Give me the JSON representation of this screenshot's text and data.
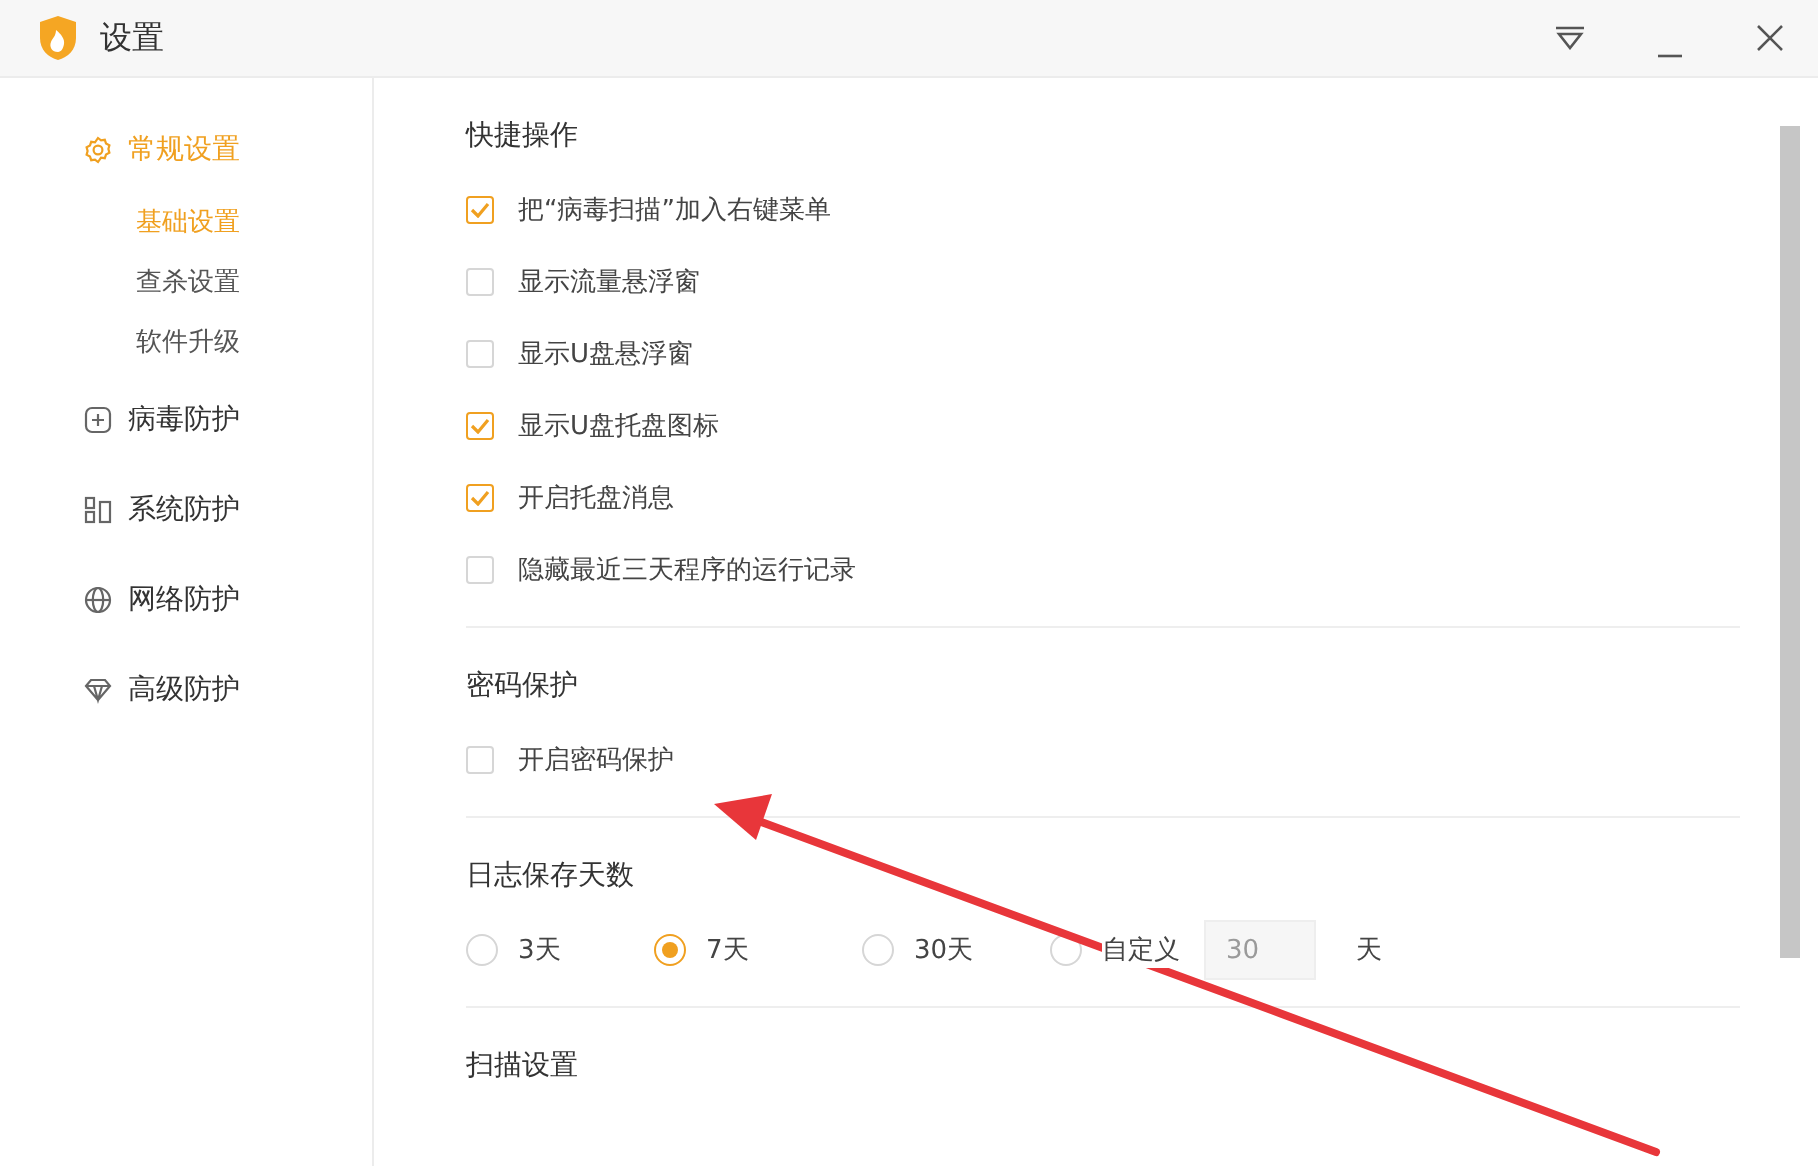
{
  "window": {
    "title": "设置"
  },
  "sidebar": {
    "items": [
      {
        "label": "常规设置",
        "selected": true,
        "children": [
          {
            "label": "基础设置",
            "selected": true
          },
          {
            "label": "查杀设置",
            "selected": false
          },
          {
            "label": "软件升级",
            "selected": false
          }
        ]
      },
      {
        "label": "病毒防护",
        "selected": false
      },
      {
        "label": "系统防护",
        "selected": false
      },
      {
        "label": "网络防护",
        "selected": false
      },
      {
        "label": "高级防护",
        "selected": false
      }
    ]
  },
  "sections": [
    {
      "title": "快捷操作",
      "kind": "checkboxes",
      "options": [
        {
          "label": "把“病毒扫描”加入右键菜单",
          "checked": true
        },
        {
          "label": "显示流量悬浮窗",
          "checked": false
        },
        {
          "label": "显示U盘悬浮窗",
          "checked": false
        },
        {
          "label": "显示U盘托盘图标",
          "checked": true
        },
        {
          "label": "开启托盘消息",
          "checked": true
        },
        {
          "label": "隐藏最近三天程序的运行记录",
          "checked": false
        }
      ]
    },
    {
      "title": "密码保护",
      "kind": "checkboxes",
      "options": [
        {
          "label": "开启密码保护",
          "checked": false
        }
      ]
    },
    {
      "title": "日志保存天数",
      "kind": "radios",
      "options": [
        {
          "label": "3天",
          "selected": false
        },
        {
          "label": "7天",
          "selected": true
        },
        {
          "label": "30天",
          "selected": false
        },
        {
          "label": "自定义",
          "selected": false,
          "field": {
            "value": "30",
            "disabled": true
          },
          "unit": "天"
        }
      ]
    },
    {
      "title": "扫描设置",
      "kind": "heading"
    }
  ],
  "annotation": {
    "kind": "arrow"
  }
}
